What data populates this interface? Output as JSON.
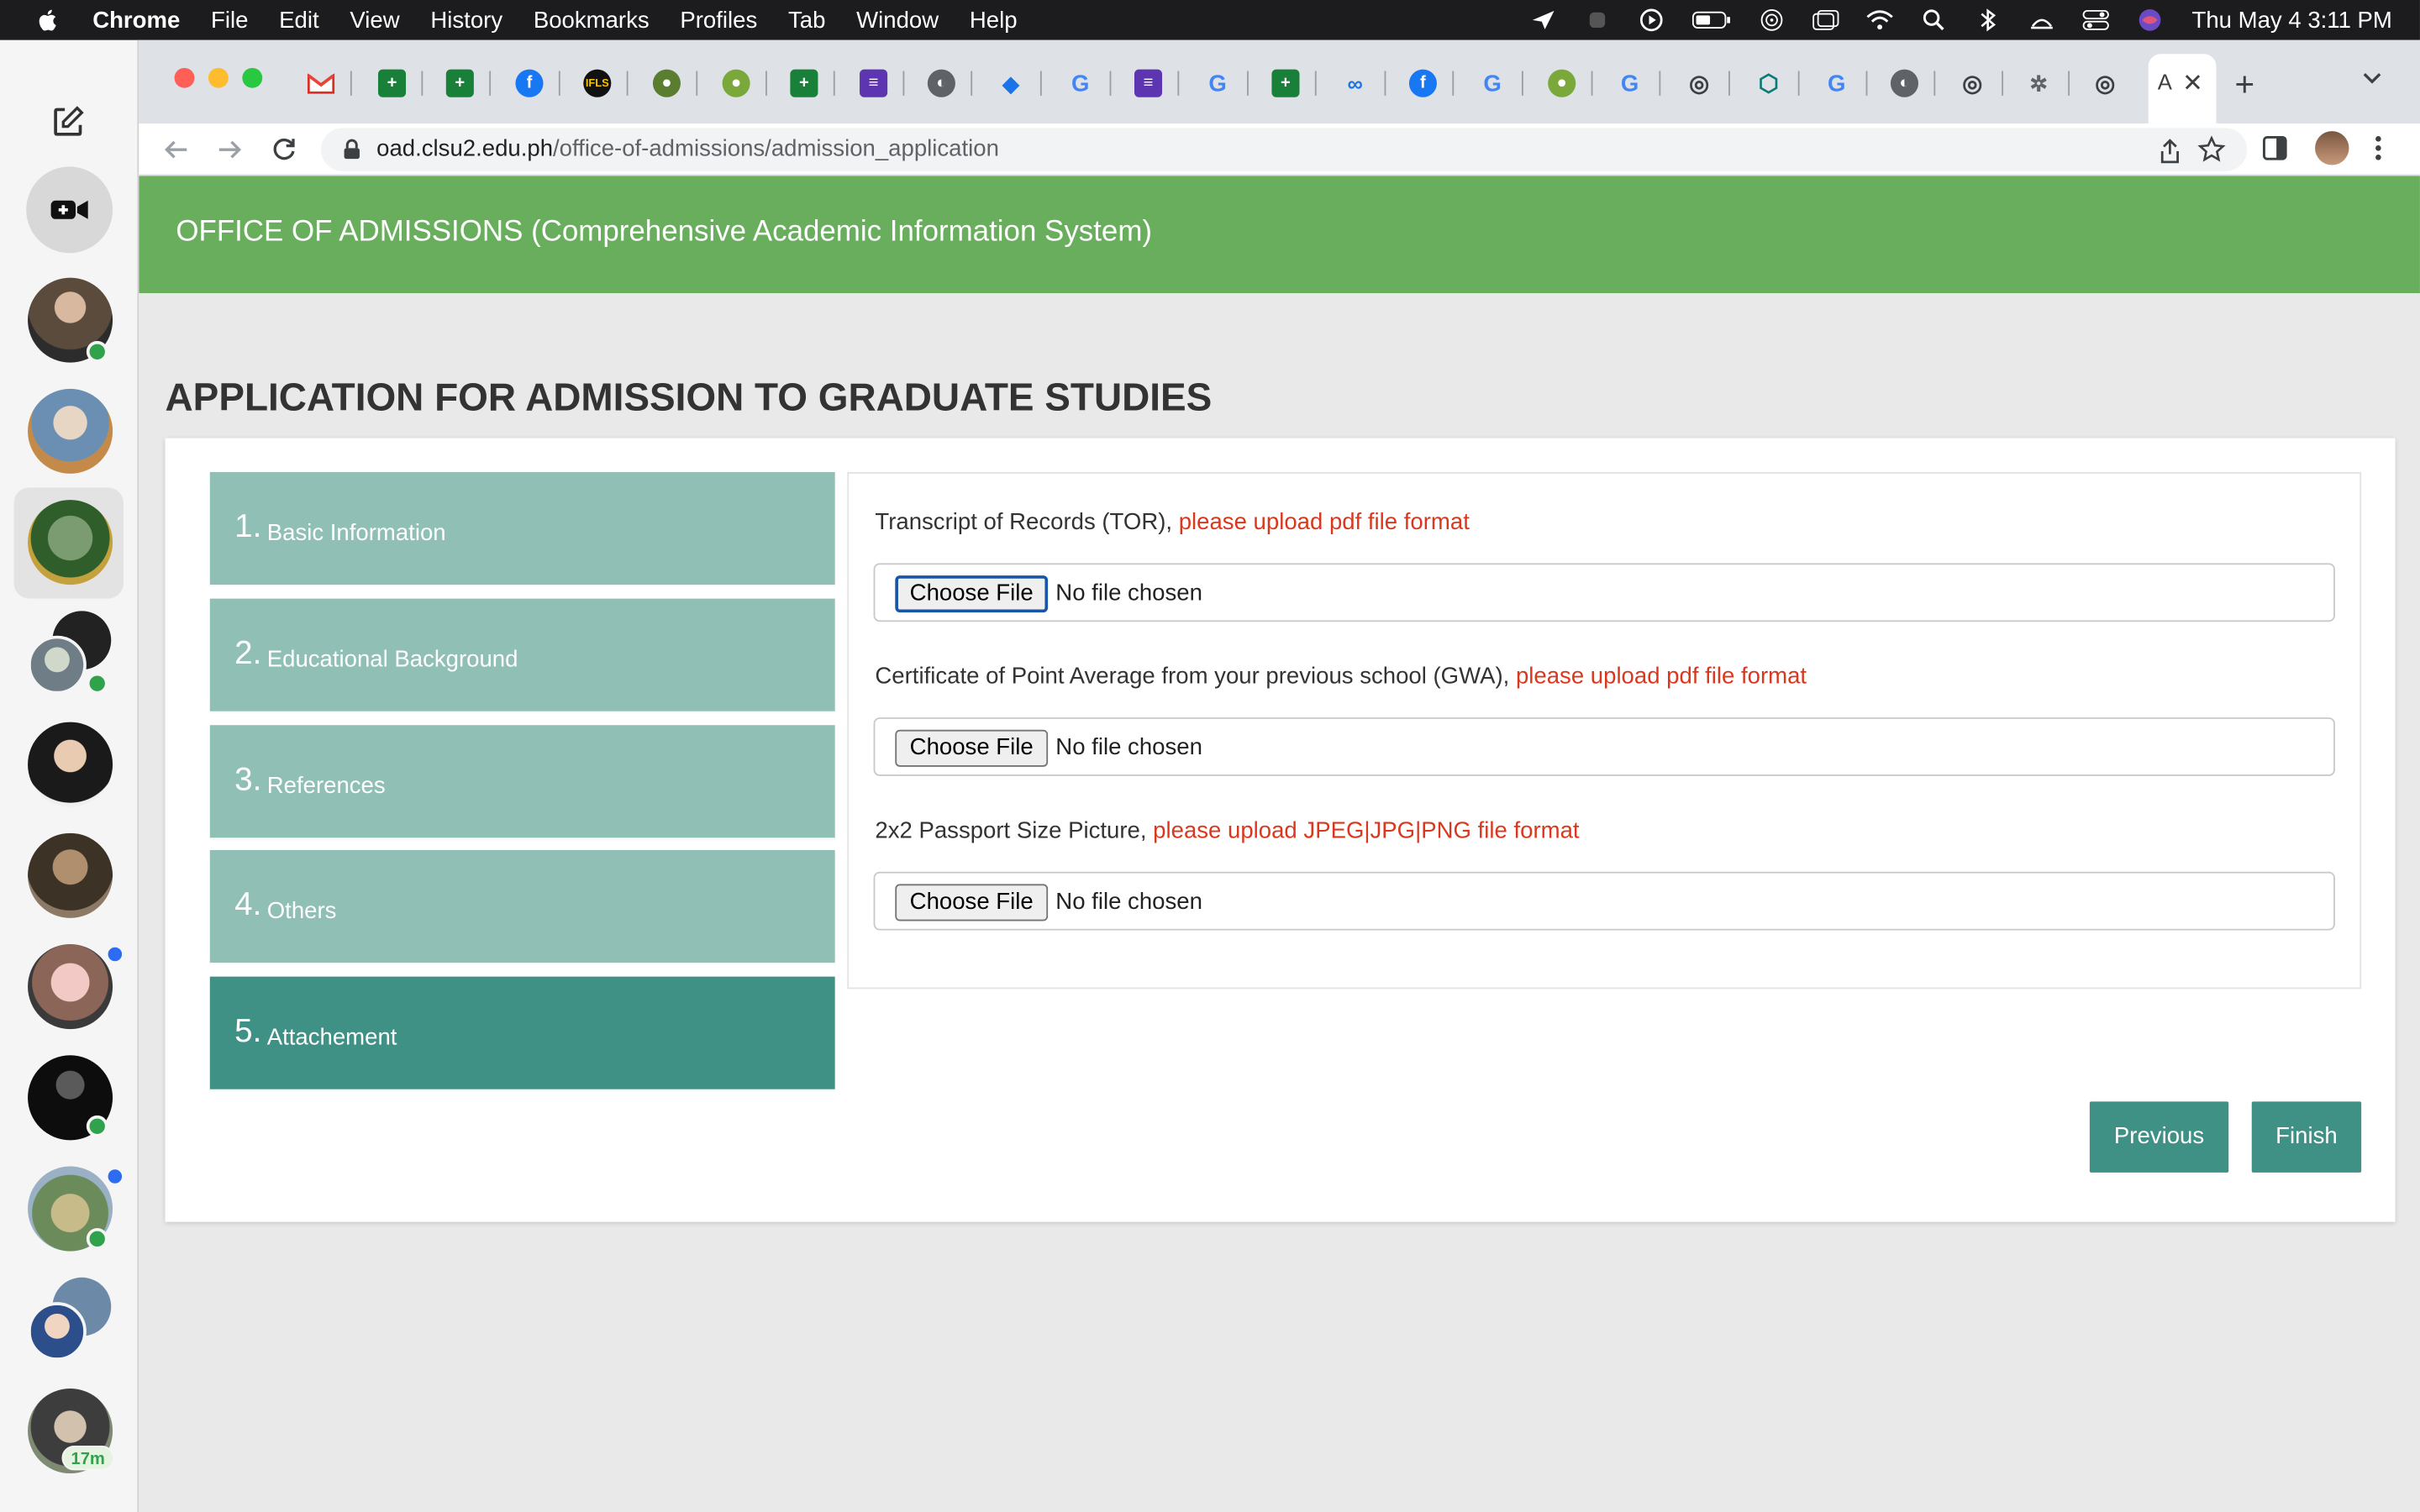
{
  "menubar": {
    "app": "Chrome",
    "items": [
      "File",
      "Edit",
      "View",
      "History",
      "Bookmarks",
      "Profiles",
      "Tab",
      "Window",
      "Help"
    ],
    "clock": "Thu May 4  3:11 PM"
  },
  "sidebar": {
    "time_badge": "17m"
  },
  "browser": {
    "url_host": "oad.clsu2.edu.ph",
    "url_path": "/office-of-admissions/admission_application",
    "active_tab_glyph": "A"
  },
  "page": {
    "banner_title": "OFFICE OF ADMISSIONS (Comprehensive Academic Information System)",
    "heading": "APPLICATION FOR ADMISSION TO GRADUATE STUDIES",
    "steps": [
      {
        "num": "1.",
        "label": "Basic Information"
      },
      {
        "num": "2.",
        "label": "Educational Background"
      },
      {
        "num": "3.",
        "label": "References"
      },
      {
        "num": "4.",
        "label": "Others"
      },
      {
        "num": "5.",
        "label": "Attachement"
      }
    ],
    "fields": [
      {
        "label": "Transcript of Records (TOR), ",
        "hint": "please upload pdf file format",
        "button": "Choose File",
        "status": "No file chosen"
      },
      {
        "label": "Certificate of Point Average from your previous school (GWA), ",
        "hint": "please upload pdf file format",
        "button": "Choose File",
        "status": "No file chosen"
      },
      {
        "label": "2x2 Passport Size Picture, ",
        "hint": "please upload JPEG|JPG|PNG file format",
        "button": "Choose File",
        "status": "No file chosen"
      }
    ],
    "previous_label": "Previous",
    "finish_label": "Finish"
  },
  "colors": {
    "banner": "#68ae5c",
    "step_inactive": "#8fbfb5",
    "step_active": "#409185",
    "hint_text": "#d9381e"
  }
}
